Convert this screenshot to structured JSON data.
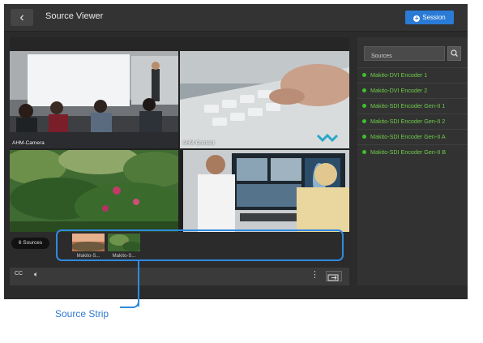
{
  "header": {
    "back_icon": "chevron-left-icon",
    "title": "Source Viewer",
    "session_label": "Session"
  },
  "tiles": [
    {
      "label": "AHM-Camera"
    },
    {
      "label": "AHM-Content"
    },
    {
      "label": ""
    },
    {
      "label": ""
    }
  ],
  "strip": {
    "count_label": "6 Sources",
    "thumbnails": [
      {
        "caption": "Makito-S..."
      },
      {
        "caption": "Makito-S..."
      }
    ]
  },
  "controls": {
    "cc_label": "CC",
    "volume_icon": "volume-icon",
    "more_icon": "more-vertical-icon",
    "exit_icon": "exit-view-icon"
  },
  "sidebar": {
    "search_placeholder": "Sources",
    "search_icon": "search-icon",
    "sources": [
      "Makito-DVI Encoder 1",
      "Makito-DVI Encoder 2",
      "Makito-SDI Encoder Gen-II 1",
      "Makito-SDI Encoder Gen-II 2",
      "Makito-SDI Encoder Gen-II A",
      "Makito-SDI Encoder Gen-II B"
    ],
    "status_color": "#3fbf2f"
  },
  "annotation": {
    "label": "Source Strip",
    "color": "#2f8ae0"
  }
}
